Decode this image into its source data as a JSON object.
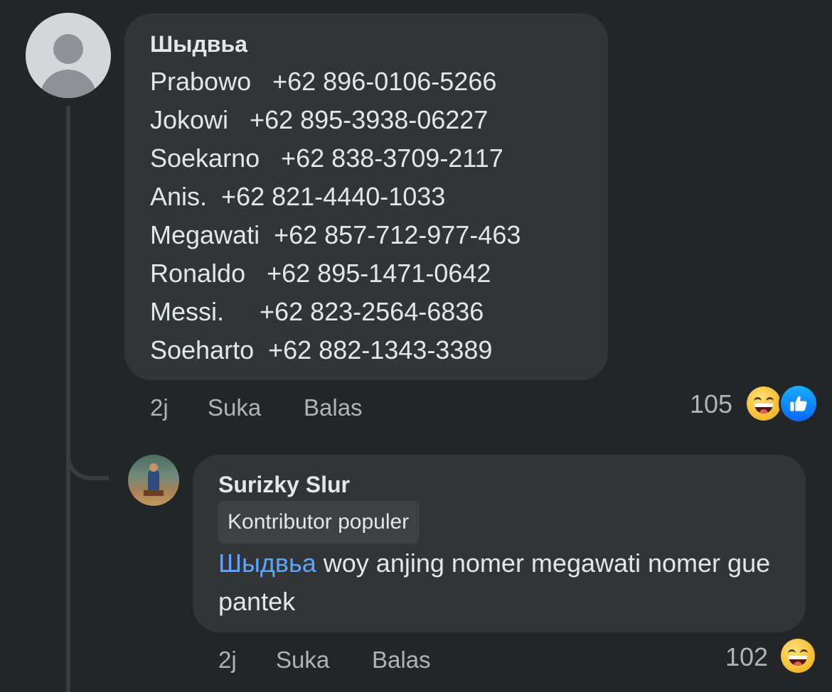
{
  "comment": {
    "author": "Шыдвьа",
    "contacts": [
      "Prabowo   +62 896-0106-5266",
      "Jokowi   +62 895-3938-06227",
      "Soekarno   +62 838-3709-2117",
      "Anis.  +62 821-4440-1033",
      "Megawati  +62 857-712-977-463",
      "Ronaldo   +62 895-1471-0642",
      "Messi.     +62 823-2564-6836",
      "Soeharto  +62 882-1343-3389"
    ],
    "time": "2j",
    "like_label": "Suka",
    "reply_label": "Balas",
    "reaction_count": "105",
    "reactions": [
      "haha-emoji",
      "like-icon"
    ]
  },
  "reply": {
    "author": "Surizky Slur",
    "badge": "Kontributor populer",
    "mention": "Шыдвьа",
    "text": " woy anjing nomer megawati nomer gue pantek",
    "time": "2j",
    "like_label": "Suka",
    "reply_label": "Balas",
    "reaction_count": "102",
    "reactions": [
      "haha-emoji"
    ]
  }
}
